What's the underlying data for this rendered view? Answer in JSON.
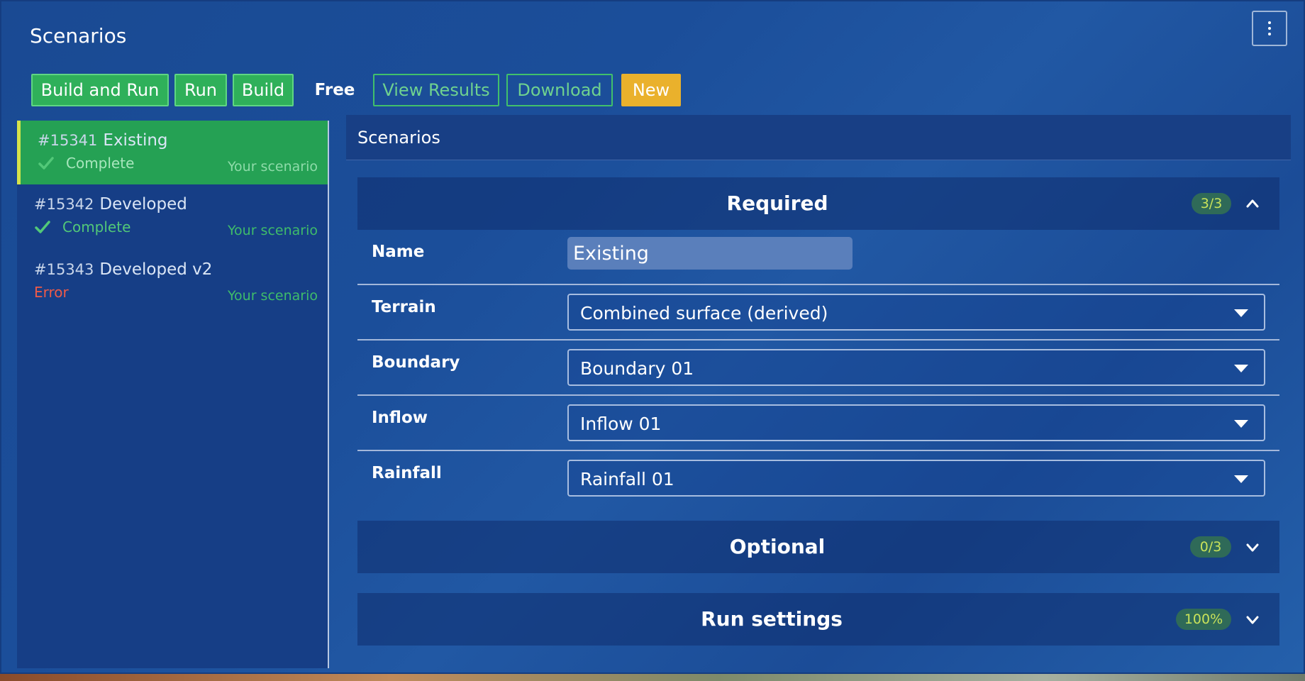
{
  "panel": {
    "title": "Scenarios"
  },
  "toolbar": {
    "build_and_run": "Build and Run",
    "run": "Run",
    "build": "Build",
    "free": "Free",
    "view_results": "View Results",
    "download": "Download",
    "new": "New"
  },
  "scenarios": [
    {
      "number": "#15341",
      "name": "Existing",
      "status": "Complete",
      "owner": "Your scenario",
      "active": true
    },
    {
      "number": "#15342",
      "name": "Developed",
      "status": "Complete",
      "owner": "Your scenario",
      "active": false
    },
    {
      "number": "#15343",
      "name": "Developed v2",
      "status": "Error",
      "owner": "Your scenario",
      "active": false
    }
  ],
  "main": {
    "header": "Scenarios",
    "required": {
      "title": "Required",
      "badge": "3/3",
      "expanded": true,
      "fields": {
        "name": {
          "label": "Name",
          "value": "Existing"
        },
        "terrain": {
          "label": "Terrain",
          "value": "Combined surface (derived)"
        },
        "boundary": {
          "label": "Boundary",
          "value": "Boundary 01"
        },
        "inflow": {
          "label": "Inflow",
          "value": "Inflow 01"
        },
        "rainfall": {
          "label": "Rainfall",
          "value": "Rainfall 01"
        }
      }
    },
    "optional": {
      "title": "Optional",
      "badge": "0/3",
      "expanded": false
    },
    "run_settings": {
      "title": "Run settings",
      "badge": "100%",
      "expanded": false
    }
  },
  "colors": {
    "panel_bg": "#1b4e9a",
    "active_item": "#25a154",
    "accent_green": "#2fb05a",
    "accent_yellow": "#eab12c",
    "error": "#ee5a48"
  },
  "icons": [
    "kebab-menu-icon",
    "check-icon",
    "chevron-up-icon",
    "chevron-down-icon",
    "dropdown-caret-icon"
  ]
}
